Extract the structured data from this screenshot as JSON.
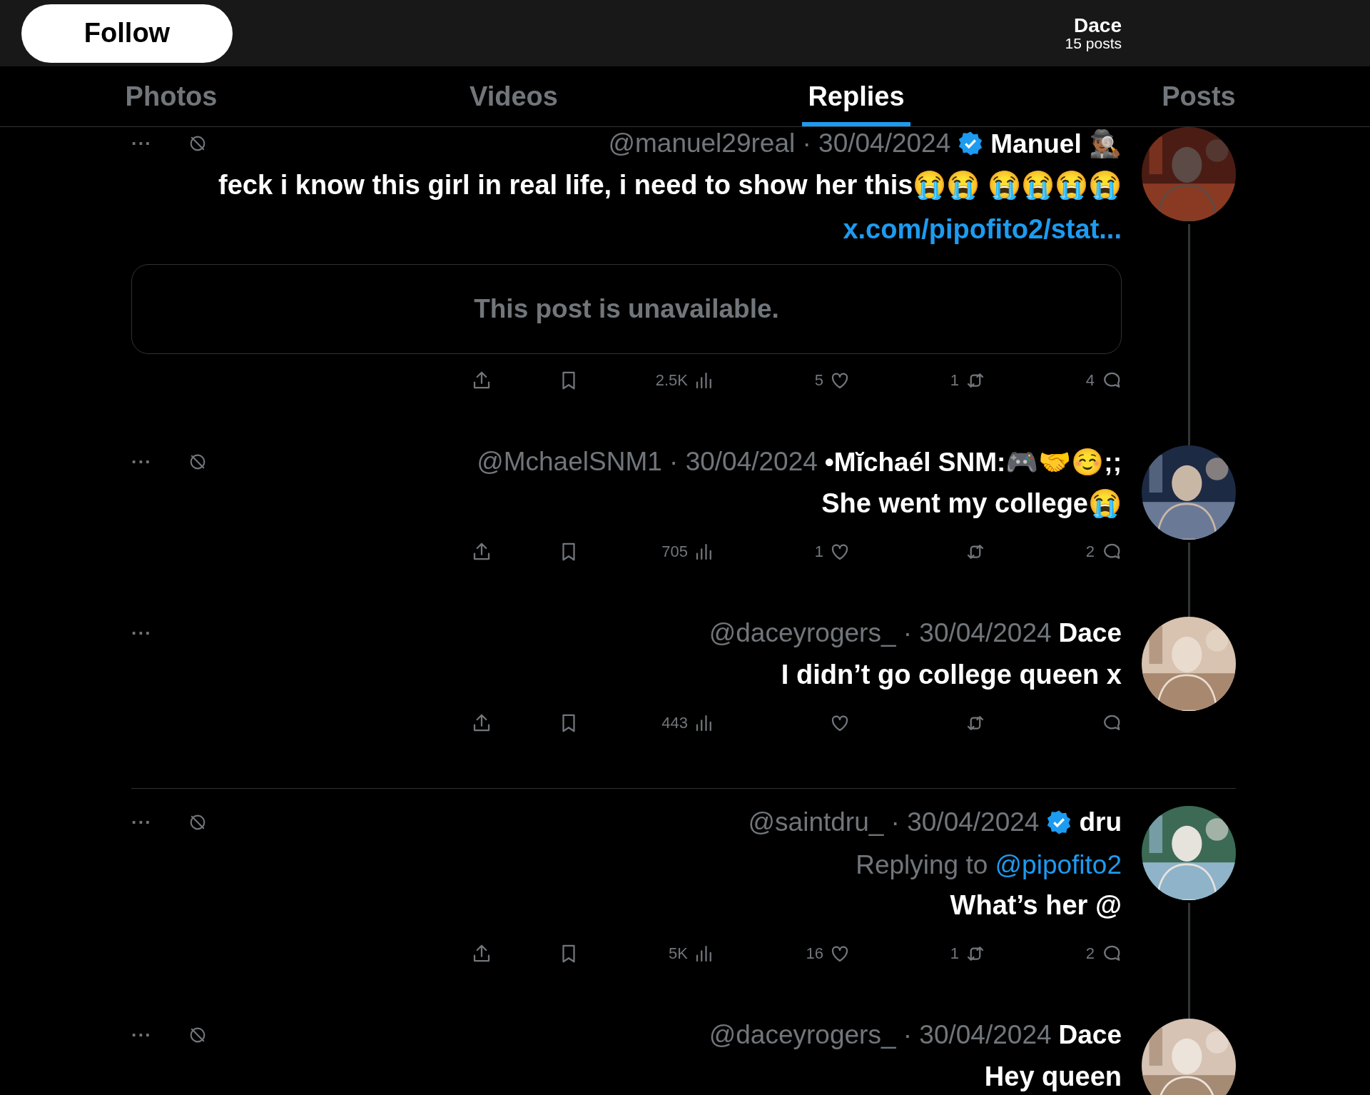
{
  "header": {
    "title": "Dace",
    "subtitle": "15 posts",
    "follow_button": "Follow"
  },
  "tabs": [
    {
      "label": "Photos",
      "selected": false
    },
    {
      "label": "Videos",
      "selected": false
    },
    {
      "label": "Replies",
      "selected": true
    },
    {
      "label": "Posts",
      "selected": false
    }
  ],
  "posts": [
    {
      "name": "Manuel 🕵🏾‍♂️",
      "verified": true,
      "meta": "@manuel29real · 30/04/2024",
      "slash_icon": true,
      "more": "···",
      "body": "feck i know this girl in real life, i need to show her this😭😭 😭😭😭😭 ",
      "link": "x.com/pipofito2/stat...",
      "quote": {
        "text": "This post is unavailable."
      },
      "thread_line": true,
      "actions": {
        "replies": "4",
        "reposts": "1",
        "likes": "5",
        "views": "2.5K"
      }
    },
    {
      "name": "•Mĭchaél SNM:🎮🤝☺️;;",
      "verified": false,
      "meta": "@MchaelSNM1 · 30/04/2024",
      "slash_icon": true,
      "more": "···",
      "body": "She went my college😭",
      "thread_line": true,
      "actions": {
        "replies": "2",
        "likes": "1",
        "views": "705"
      }
    },
    {
      "name": "Dace",
      "verified": false,
      "meta": "@daceyrogers_ · 30/04/2024",
      "slash_icon": false,
      "more": "···",
      "body": "I didn’t go college queen x",
      "thread_line": false,
      "divider_after": true,
      "actions": {
        "views": "443"
      }
    },
    {
      "name": "dru",
      "verified": true,
      "meta": "@saintdru_ · 30/04/2024",
      "slash_icon": true,
      "more": "···",
      "replying_to": {
        "label": "Replying to",
        "handle": "@pipofito2"
      },
      "body": "What’s her @",
      "thread_line": true,
      "actions": {
        "replies": "2",
        "reposts": "1",
        "likes": "16",
        "views": "5K"
      }
    },
    {
      "name": "Dace",
      "verified": false,
      "meta": "@daceyrogers_ · 30/04/2024",
      "slash_icon": true,
      "more": "···",
      "body": "Hey queen",
      "thread_line": false
    }
  ]
}
